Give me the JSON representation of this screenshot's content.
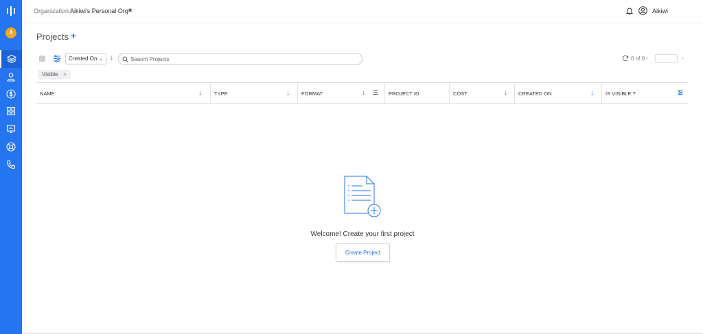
{
  "topbar": {
    "org_label": "Organization:",
    "org_name": "Aikiwi's Personal Org",
    "user_name": "Aikiwi"
  },
  "sidebar": {
    "avatar_letter": "A"
  },
  "page": {
    "title": "Projects",
    "add_label": "+"
  },
  "toolbar": {
    "sort_value": "Created On",
    "search_placeholder": "Search Projects",
    "pager_text": "0 of 0"
  },
  "filter_chip": {
    "label": "Visible",
    "remove": "×"
  },
  "table": {
    "columns": [
      {
        "label": "NAME"
      },
      {
        "label": "TYPE"
      },
      {
        "label": "FORMAT"
      },
      {
        "label": "PROJECT ID"
      },
      {
        "label": "COST"
      },
      {
        "label": "CREATED ON"
      },
      {
        "label": "IS VISIBLE ?"
      }
    ]
  },
  "empty_state": {
    "message": "Welcome! Create your first project",
    "button_label": "Create Project"
  },
  "colors": {
    "brand": "#2574f0",
    "avatar": "#f5a623"
  }
}
